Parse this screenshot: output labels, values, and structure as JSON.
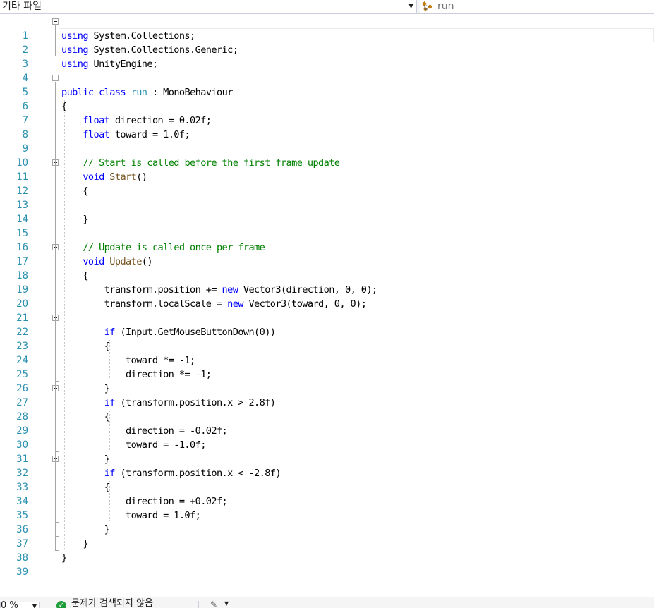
{
  "navbar": {
    "project_dropdown": "기타 파일",
    "member_dropdown": "run",
    "class_icon": "class-icon"
  },
  "editor": {
    "line_numbers": [
      "1",
      "2",
      "3",
      "4",
      "5",
      "6",
      "7",
      "8",
      "9",
      "10",
      "11",
      "12",
      "13",
      "14",
      "15",
      "16",
      "17",
      "18",
      "19",
      "20",
      "21",
      "22",
      "23",
      "24",
      "25",
      "26",
      "27",
      "28",
      "29",
      "30",
      "31",
      "32",
      "33",
      "34",
      "35",
      "36",
      "37",
      "38",
      "39"
    ],
    "lines": [
      [
        {
          "k": "k",
          "t": "using"
        },
        {
          "t": " System.Collections;"
        }
      ],
      [
        {
          "k": "k",
          "t": "using"
        },
        {
          "t": " System.Collections.Generic;"
        }
      ],
      [
        {
          "k": "k",
          "t": "using"
        },
        {
          "t": " UnityEngine;"
        }
      ],
      [],
      [
        {
          "k": "k",
          "t": "public"
        },
        {
          "t": " "
        },
        {
          "k": "k",
          "t": "class"
        },
        {
          "t": " "
        },
        {
          "k": "tp",
          "t": "run"
        },
        {
          "t": " : "
        },
        {
          "t": "MonoBehaviour"
        }
      ],
      [
        {
          "t": "{"
        }
      ],
      [
        {
          "t": "    "
        },
        {
          "k": "k",
          "t": "float"
        },
        {
          "t": " direction = 0.02f;"
        }
      ],
      [
        {
          "t": "    "
        },
        {
          "k": "k",
          "t": "float"
        },
        {
          "t": " toward = 1.0f;"
        }
      ],
      [],
      [
        {
          "t": "    "
        },
        {
          "k": "cm",
          "t": "// Start is called before the first frame update"
        }
      ],
      [
        {
          "t": "    "
        },
        {
          "k": "k",
          "t": "void"
        },
        {
          "t": " "
        },
        {
          "k": "fn",
          "t": "Start"
        },
        {
          "t": "()"
        }
      ],
      [
        {
          "t": "    {"
        }
      ],
      [],
      [
        {
          "t": "    }"
        }
      ],
      [],
      [
        {
          "t": "    "
        },
        {
          "k": "cm",
          "t": "// Update is called once per frame"
        }
      ],
      [
        {
          "t": "    "
        },
        {
          "k": "k",
          "t": "void"
        },
        {
          "t": " "
        },
        {
          "k": "fn",
          "t": "Update"
        },
        {
          "t": "()"
        }
      ],
      [
        {
          "t": "    {"
        }
      ],
      [
        {
          "t": "        transform.position += "
        },
        {
          "k": "k",
          "t": "new"
        },
        {
          "t": " Vector3(direction, 0, 0);"
        }
      ],
      [
        {
          "t": "        transform.localScale = "
        },
        {
          "k": "k",
          "t": "new"
        },
        {
          "t": " Vector3(toward, 0, 0);"
        }
      ],
      [],
      [
        {
          "t": "        "
        },
        {
          "k": "k",
          "t": "if"
        },
        {
          "t": " (Input.GetMouseButtonDown(0))"
        }
      ],
      [
        {
          "t": "        {"
        }
      ],
      [
        {
          "t": "            toward *= -1;"
        }
      ],
      [
        {
          "t": "            direction *= -1;"
        }
      ],
      [
        {
          "t": "        }"
        }
      ],
      [
        {
          "t": "        "
        },
        {
          "k": "k",
          "t": "if"
        },
        {
          "t": " (transform.position.x > 2.8f)"
        }
      ],
      [
        {
          "t": "        {"
        }
      ],
      [
        {
          "t": "            direction = -0.02f;"
        }
      ],
      [
        {
          "t": "            toward = -1.0f;"
        }
      ],
      [
        {
          "t": "        }"
        }
      ],
      [
        {
          "t": "        "
        },
        {
          "k": "k",
          "t": "if"
        },
        {
          "t": " (transform.position.x < -2.8f)"
        }
      ],
      [
        {
          "t": "        {"
        }
      ],
      [
        {
          "t": "            direction = +0.02f;"
        }
      ],
      [
        {
          "t": "            toward = 1.0f;"
        }
      ],
      [
        {
          "t": "        }"
        }
      ],
      [
        {
          "t": "    }"
        }
      ],
      [
        {
          "t": "}"
        }
      ],
      []
    ]
  },
  "statusbar": {
    "zoom": "0 %",
    "issues": "문제가 검색되지 않음",
    "check_icon": "check-circle-icon",
    "brush_icon": "brush-icon"
  },
  "colors": {
    "keyword": "#0000ff",
    "type": "#2b91af",
    "method": "#74531f",
    "comment": "#008000",
    "line_number": "#2b91af"
  }
}
